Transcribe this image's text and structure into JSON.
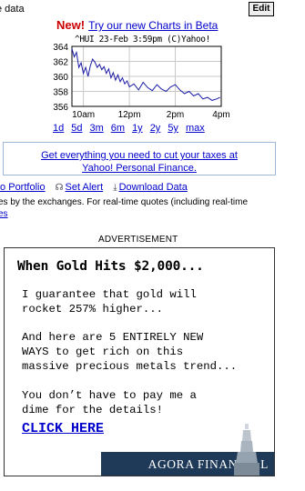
{
  "header": {
    "fragment_text": "e data",
    "edit_label": "Edit"
  },
  "promo": {
    "new_label": "New!",
    "link_text": "Try our new Charts in Beta"
  },
  "chart_caption": "^HUI 23-Feb 3:59pm (C)Yahoo!",
  "chart_data": {
    "type": "line",
    "title": "",
    "xlabel": "",
    "ylabel": "",
    "x_ticks": [
      "10am",
      "12pm",
      "2pm",
      "4pm"
    ],
    "y_ticks": [
      356,
      358,
      360,
      362,
      364
    ],
    "ylim": [
      356,
      364
    ],
    "grid": true,
    "x_range_hours": [
      9.5,
      16
    ],
    "series": [
      {
        "x": [
          9.5,
          9.6,
          9.7,
          9.8,
          9.9,
          10.0,
          10.1,
          10.2,
          10.3,
          10.4,
          10.5,
          10.6,
          10.7,
          10.8,
          10.9,
          11.0,
          11.1,
          11.2,
          11.3,
          11.4,
          11.5,
          11.6,
          11.7,
          11.8,
          11.9,
          12.0,
          12.2,
          12.4,
          12.6,
          12.8,
          13.0,
          13.2,
          13.4,
          13.6,
          13.8,
          14.0,
          14.2,
          14.4,
          14.6,
          14.8,
          15.0,
          15.2,
          15.4,
          15.6,
          15.8,
          15.95
        ],
        "values": [
          363.7,
          362.6,
          363.2,
          361.2,
          361.8,
          360.4,
          361.2,
          360.0,
          361.4,
          362.3,
          361.9,
          361.2,
          361.6,
          360.9,
          361.3,
          360.4,
          361.0,
          359.8,
          360.5,
          359.5,
          360.2,
          359.3,
          359.8,
          359.0,
          359.4,
          358.6,
          359.0,
          358.2,
          359.2,
          358.5,
          358.1,
          358.9,
          358.3,
          358.0,
          358.6,
          358.9,
          358.2,
          357.7,
          358.0,
          357.4,
          357.7,
          357.0,
          357.2,
          356.8,
          357.0,
          357.2
        ]
      }
    ],
    "line_color": "#1a1aa6",
    "grid_color": "#c8c8c8"
  },
  "range_links": [
    "1d",
    "5d",
    "3m",
    "6m",
    "1y",
    "2y",
    "5y",
    "max"
  ],
  "tax_box": {
    "line1": "Get everything you need to cut your taxes at",
    "line2": "Yahoo! Personal Finance."
  },
  "links_row": {
    "portfolio": "to Portfolio",
    "alert": "Set Alert",
    "download": "Download Data"
  },
  "note": {
    "line": "es by the exchanges. For real-time quotes (including real-time",
    "link": "es"
  },
  "advertisement_label": "ADVERTISEMENT",
  "ad": {
    "headline": "When Gold Hits $2,000...",
    "para1": [
      "I guarantee that gold will",
      "rocket 257% higher..."
    ],
    "para2": [
      "And here are 5 ENTIRELY NEW",
      "WAYS to get rich on this",
      "massive precious metals trend..."
    ],
    "para3": [
      "You don’t have to pay me a",
      "dime for the details!"
    ],
    "cta": "CLICK HERE",
    "brand": "AGORA FINANCIAL",
    "footer_color": "#1f3a58"
  }
}
